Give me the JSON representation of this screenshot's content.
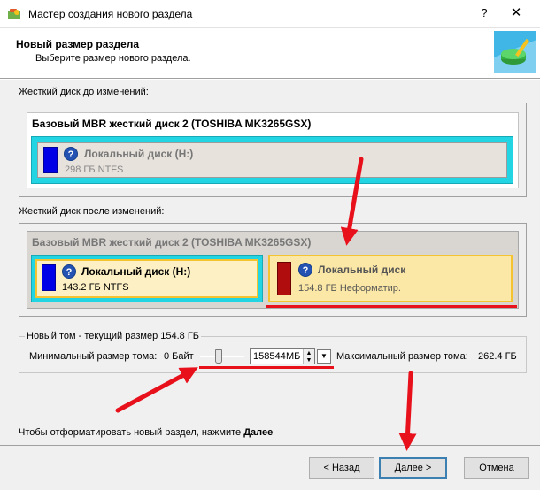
{
  "window": {
    "title": "Мастер создания нового раздела",
    "help_glyph": "?",
    "close_glyph": "✕"
  },
  "header": {
    "title": "Новый размер раздела",
    "subtitle": "Выберите размер нового раздела."
  },
  "before": {
    "label": "Жесткий диск до изменений:",
    "disk_title": "Базовый MBR жесткий диск 2 (TOSHIBA MK3265GSX)",
    "partition": {
      "name": "Локальный диск (H:)",
      "info": "298 ГБ NTFS"
    }
  },
  "after": {
    "label": "Жесткий диск после изменений:",
    "disk_title": "Базовый MBR жесткий диск 2 (TOSHIBA MK3265GSX)",
    "partition1": {
      "name": "Локальный диск (H:)",
      "info": "143.2 ГБ NTFS"
    },
    "partition2": {
      "name": "Локальный диск",
      "info": "154.8 ГБ Неформатир."
    }
  },
  "volume": {
    "group_label": "Новый том - текущий размер 154.8 ГБ",
    "min_label": "Минимальный размер тома:",
    "min_value": "0 Байт",
    "size_value": "158544",
    "unit": "МБ",
    "max_label": "Максимальный размер тома:",
    "max_value": "262.4 ГБ",
    "slider_level": 0.38
  },
  "hint": {
    "text": "Чтобы отформатировать новый раздел, нажмите ",
    "bold": "Далее"
  },
  "buttons": {
    "back": "< Назад",
    "next": "Далее >",
    "cancel": "Отмена"
  },
  "colors": {
    "annotation_red": "#e8101b",
    "partition_cyan": "#23d4e2",
    "partition_yellow": "#fce8a6"
  }
}
